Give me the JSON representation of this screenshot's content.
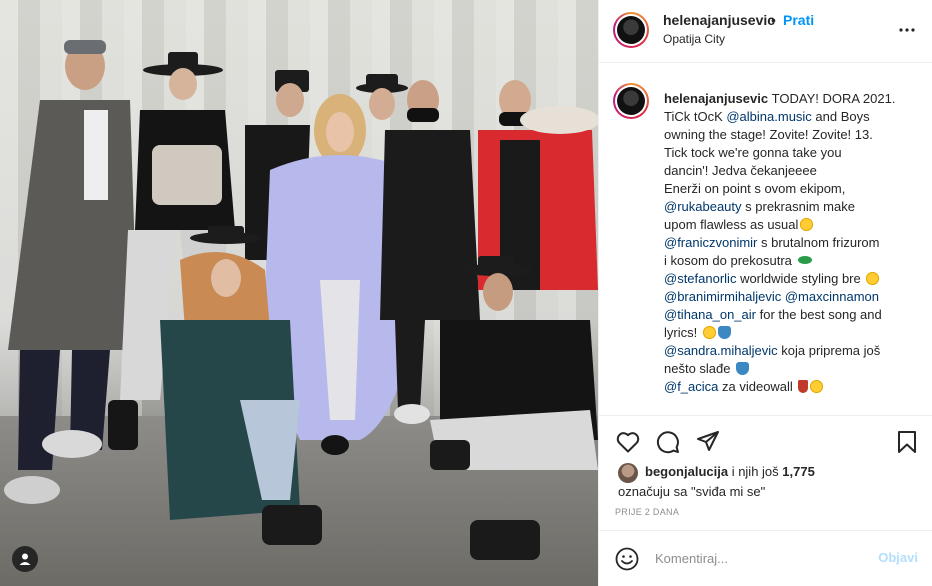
{
  "post": {
    "image_alt": "",
    "username": "helenajanjusevic",
    "follow_label": "Prati",
    "separator": "•",
    "location": "Opatija City"
  },
  "caption": {
    "username": "helenajanjusevic",
    "lines": [
      [
        {
          "t": "TODAY! DORA 2021."
        }
      ],
      [
        {
          "t": "TiCk tOcK "
        },
        {
          "m": "@albina.music"
        },
        {
          "t": " and Boys"
        }
      ],
      [
        {
          "t": "owning the stage! Zovite! Zovite! 13."
        }
      ],
      [
        {
          "t": "Tick tock we're gonna take you"
        }
      ],
      [
        {
          "t": "dancin'! Jedva čekanjeeee"
        }
      ],
      [
        {
          "t": "Enerži on point s ovom ekipom,"
        }
      ],
      [
        {
          "m": "@rukabeauty"
        },
        {
          "t": " s prekrasnim make"
        }
      ],
      [
        {
          "t": "upom flawless as usual"
        },
        {
          "e": "face"
        }
      ],
      [
        {
          "m": "@franiczvonimir"
        },
        {
          "t": " s brutalnom frizurom"
        }
      ],
      [
        {
          "t": "i kosom do prekosutra "
        },
        {
          "e": "fish"
        }
      ],
      [
        {
          "m": "@stefanorlic"
        },
        {
          "t": " worldwide styling bre "
        },
        {
          "e": "face"
        }
      ],
      [
        {
          "m": "@branimirmihaljevic"
        },
        {
          "t": " "
        },
        {
          "m": "@maxcinnamon"
        }
      ],
      [
        {
          "m": "@tihana_on_air"
        },
        {
          "t": " for the best song and"
        }
      ],
      [
        {
          "t": "lyrics! "
        },
        {
          "e": "face"
        },
        {
          "e": "heart"
        }
      ],
      [
        {
          "m": "@sandra.mihaljevic"
        },
        {
          "t": " koja priprema još"
        }
      ],
      [
        {
          "t": "nešto slađe "
        },
        {
          "e": "heart"
        }
      ],
      [
        {
          "m": "@f_acica"
        },
        {
          "t": " za videowall "
        },
        {
          "e": "dress"
        },
        {
          "e": "face"
        }
      ]
    ]
  },
  "likes": {
    "user": "begonjalucija",
    "middle": " i njih još ",
    "count": "1,775",
    "line2": "označuju sa \"sviđa mi se\""
  },
  "timestamp": "PRIJE 2 DANA",
  "comment": {
    "placeholder": "Komentiraj...",
    "post_label": "Objavi"
  },
  "colors": {
    "accent": "#0095f6",
    "mention": "#00376b",
    "post_disabled": "#b2dffc",
    "muted": "#8e8e8e"
  },
  "icons": {
    "more": "more-horizontal-icon",
    "like": "heart-icon",
    "comment": "comment-icon",
    "share": "paper-plane-icon",
    "save": "bookmark-icon",
    "emoji": "smiley-icon",
    "tagged": "user-tag-icon"
  }
}
